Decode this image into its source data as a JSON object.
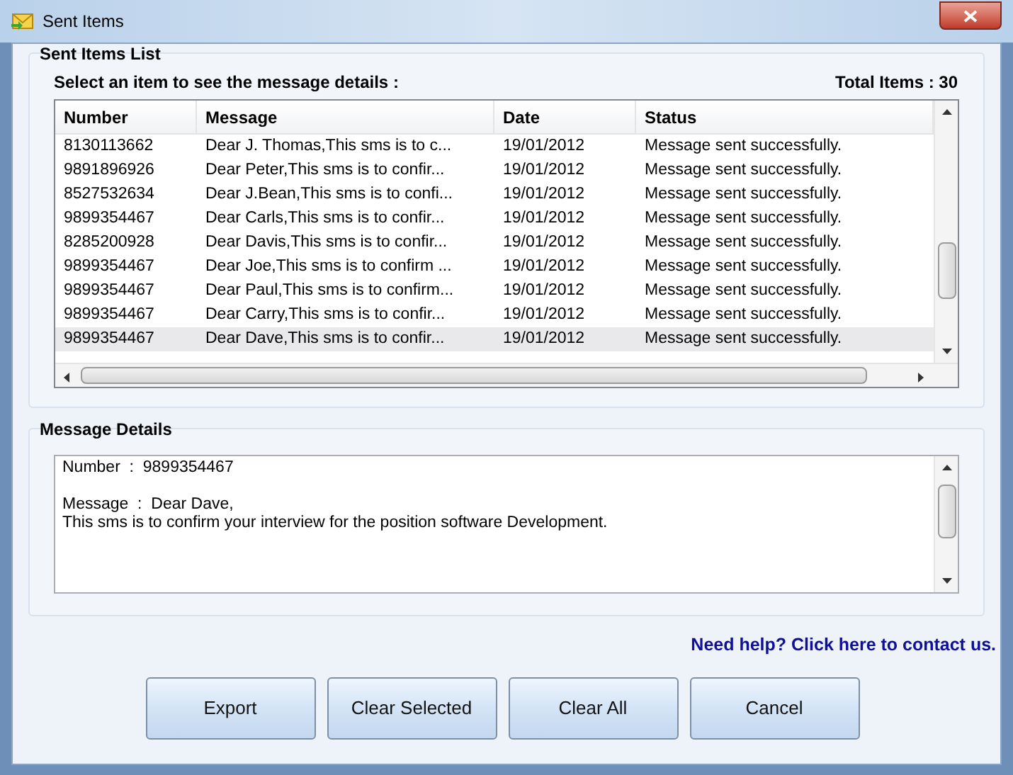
{
  "window": {
    "title": "Sent Items"
  },
  "list_group": {
    "title": "Sent Items List",
    "instruction": "Select an item to see the message details :",
    "total": "Total Items : 30"
  },
  "table": {
    "columns": [
      "Number",
      "Message",
      "Date",
      "Status"
    ],
    "rows": [
      {
        "cells": [
          "8130113662",
          "Dear J. Thomas,This sms is to c...",
          "19/01/2012",
          "Message sent successfully."
        ],
        "selected": false
      },
      {
        "cells": [
          "9891896926",
          "Dear Peter,This sms is to confir...",
          "19/01/2012",
          "Message sent successfully."
        ],
        "selected": false
      },
      {
        "cells": [
          "8527532634",
          "Dear J.Bean,This sms is to confi...",
          "19/01/2012",
          "Message sent successfully."
        ],
        "selected": false
      },
      {
        "cells": [
          "9899354467",
          "Dear Carls,This sms is to confir...",
          "19/01/2012",
          "Message sent successfully."
        ],
        "selected": false
      },
      {
        "cells": [
          "8285200928",
          "Dear Davis,This sms is to confir...",
          "19/01/2012",
          "Message sent successfully."
        ],
        "selected": false
      },
      {
        "cells": [
          "9899354467",
          "Dear Joe,This sms is to confirm ...",
          "19/01/2012",
          "Message sent successfully."
        ],
        "selected": false
      },
      {
        "cells": [
          "9899354467",
          "Dear Paul,This sms is to confirm...",
          "19/01/2012",
          "Message sent successfully."
        ],
        "selected": false
      },
      {
        "cells": [
          "9899354467",
          "Dear Carry,This sms is to confir...",
          "19/01/2012",
          "Message sent successfully."
        ],
        "selected": false
      },
      {
        "cells": [
          "9899354467",
          "Dear Dave,This sms is to confir...",
          "19/01/2012",
          "Message sent successfully."
        ],
        "selected": true
      }
    ]
  },
  "details_group": {
    "title": "Message Details",
    "number_line": "Number  :  9899354467",
    "message_lines": [
      "Message  :  Dear Dave,",
      "This sms is to confirm your interview for the position software Development."
    ]
  },
  "help_link": "Need help? Click here to contact us.",
  "buttons": [
    "Export",
    "Clear Selected",
    "Clear All",
    "Cancel"
  ]
}
